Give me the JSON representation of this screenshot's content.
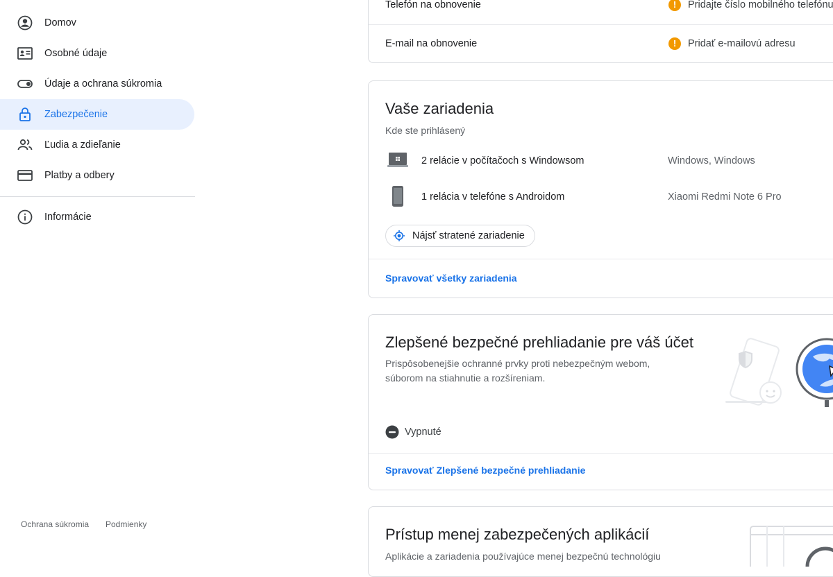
{
  "sidebar": {
    "items": [
      {
        "label": "Domov",
        "icon": "account-circle-icon"
      },
      {
        "label": "Osobné údaje",
        "icon": "id-card-icon"
      },
      {
        "label": "Údaje a ochrana súkromia",
        "icon": "toggle-icon"
      },
      {
        "label": "Zabezpečenie",
        "icon": "lock-icon",
        "active": true
      },
      {
        "label": "Ľudia a zdieľanie",
        "icon": "people-icon"
      },
      {
        "label": "Platby a odbery",
        "icon": "credit-card-icon"
      },
      {
        "label": "Informácie",
        "icon": "info-icon"
      }
    ],
    "footer": {
      "privacy": "Ochrana súkromia",
      "terms": "Podmienky"
    }
  },
  "recovery": {
    "phone_label": "Telefón na obnovenie",
    "phone_value": "Pridajte číslo mobilného telefónu",
    "email_label": "E-mail na obnovenie",
    "email_value": "Pridať e-mailovú adresu"
  },
  "devices": {
    "title": "Vaše zariadenia",
    "subtitle": "Kde ste prihlásený",
    "list": [
      {
        "text": "2 relácie v počítačoch s Windowsom",
        "model": "Windows, Windows",
        "icon": "laptop-icon"
      },
      {
        "text": "1 relácia v telefóne s Androidom",
        "model": "Xiaomi Redmi Note 6 Pro",
        "icon": "phone-icon"
      }
    ],
    "find_button": "Nájsť stratené zariadenie",
    "manage_link": "Spravovať všetky zariadenia"
  },
  "safe_browsing": {
    "title": "Zlepšené bezpečné prehliadanie pre váš účet",
    "description_line1": "Prispôsobenejšie ochranné prvky proti nebezpečným webom,",
    "description_line2": "súborom na stiahnutie a rozšíreniam.",
    "status": "Vypnuté",
    "manage_link": "Spravovať Zlepšené bezpečné prehliadanie"
  },
  "less_secure": {
    "title": "Prístup menej zabezpečených aplikácií",
    "description": "Aplikácie a zariadenia používajúce menej bezpečnú technológiu"
  },
  "colors": {
    "accent": "#1a73e8",
    "warning": "#f29900",
    "active_bg": "#e8f0fe"
  }
}
